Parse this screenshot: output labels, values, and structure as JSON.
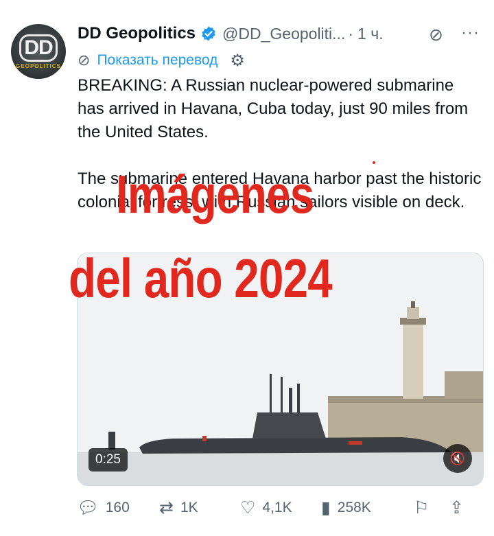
{
  "post": {
    "author_name": "DD Geopolitics",
    "handle": "@DD_Geopoliti...",
    "separator": "·",
    "time": "1 ч.",
    "avatar_logo": "DD",
    "avatar_subtitle": "GEOPOLITICS",
    "translate_label": "Показать перевод",
    "paragraphs": [
      "BREAKING: A Russian nuclear-powered submarine has arrived in Havana, Cuba today, just 90 miles from the United States.",
      "The submarine entered Havana harbor past the historic colonial fortress, with Russian sailors visible on deck."
    ],
    "icons": {
      "verified": "verified-badge-icon",
      "grok": "grok-icon",
      "more": "more-icon",
      "translate": "translate-icon",
      "settings": "gear-icon"
    }
  },
  "media": {
    "duration": "0:25",
    "mute_icon": "mute-icon"
  },
  "overlay": {
    "line1": "Imágenes",
    "line2": "del año 2024",
    "color": "#e0281e"
  },
  "actions": {
    "replies": "160",
    "reposts": "1K",
    "likes": "4,1K",
    "views": "258K"
  },
  "colors": {
    "accent": "#1d9bf0",
    "text": "#0f1419",
    "muted": "#536471"
  }
}
